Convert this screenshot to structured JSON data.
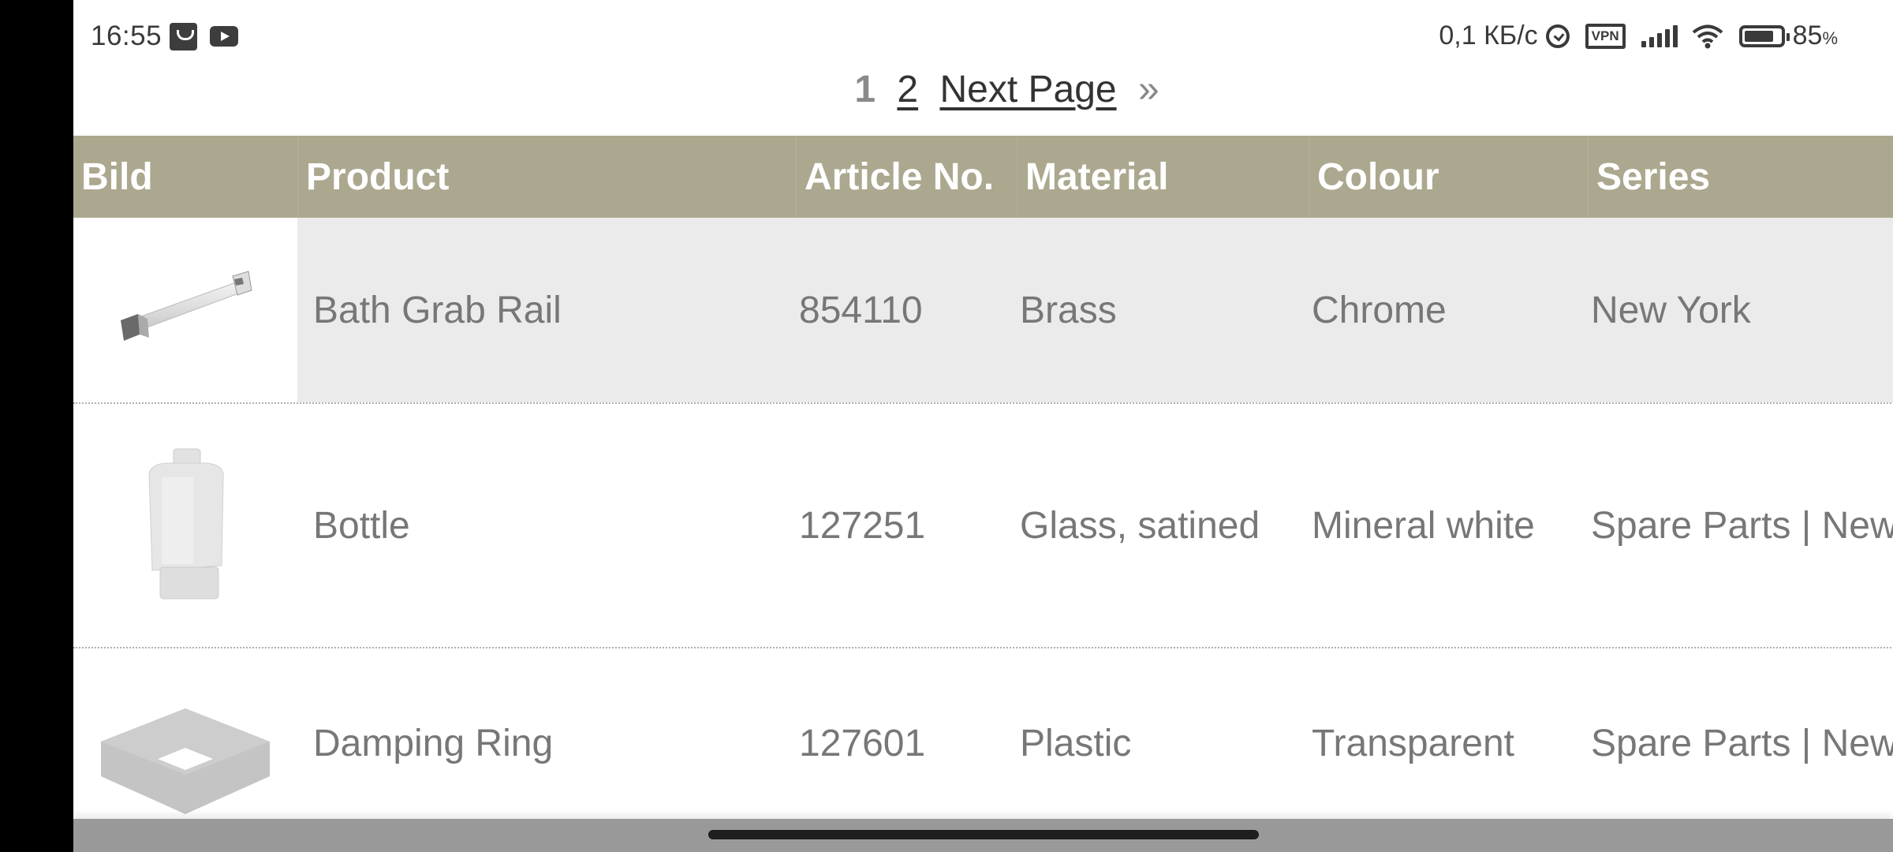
{
  "status_bar": {
    "time": "16:55",
    "notification_icons": [
      "shop-icon",
      "youtube-icon"
    ],
    "network_speed": "0,1 КБ/с",
    "system_icons": [
      "alarm-icon",
      "vpn-icon",
      "signal-icon",
      "wifi-icon",
      "battery-icon"
    ],
    "vpn_label": "VPN",
    "battery_level": 0.85,
    "battery_percent": "85",
    "battery_unit": "%"
  },
  "pagination": {
    "current_page": "1",
    "pages": [
      "2"
    ],
    "next_label": "Next Page",
    "next_glyph": "»"
  },
  "table": {
    "columns": [
      "Bild",
      "Product",
      "Article No.",
      "Material",
      "Colour",
      "Series"
    ],
    "rows": [
      {
        "image": "bath-grab-rail-image",
        "product": "Bath Grab Rail",
        "article_no": "854110",
        "material": "Brass",
        "colour": "Chrome",
        "series": "New York"
      },
      {
        "image": "bottle-image",
        "product": "Bottle",
        "article_no": "127251",
        "material": "Glass, satined",
        "colour": "Mineral white",
        "series": "Spare Parts | New"
      },
      {
        "image": "damping-ring-image",
        "product": "Damping Ring",
        "article_no": "127601",
        "material": "Plastic",
        "colour": "Transparent",
        "series": "Spare Parts | New"
      }
    ]
  },
  "colors": {
    "header_bg": "#aca88f",
    "row_highlight": "#ebebeb",
    "cell_text": "#777777"
  }
}
